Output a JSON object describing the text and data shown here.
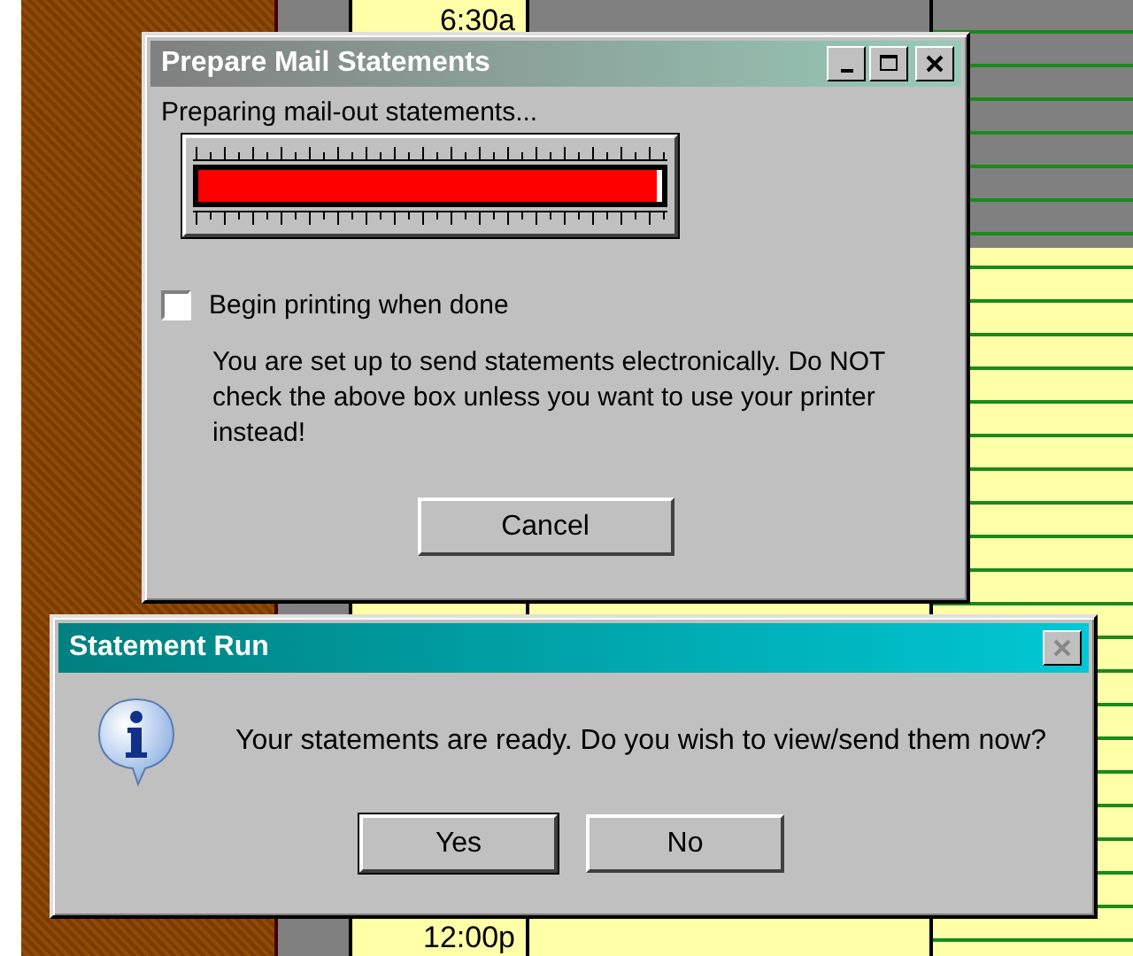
{
  "background": {
    "time_labels": [
      "6:30a",
      "12:00p"
    ]
  },
  "progress_dialog": {
    "title": "Prepare Mail Statements",
    "status": "Preparing mail-out statements...",
    "progress": {
      "level": 0.99
    },
    "checkbox": {
      "label": "Begin printing when done",
      "checked": false
    },
    "note": "You are set up to send statements electronically. Do NOT check the above box unless you want to use your printer instead!",
    "buttons": [
      "Cancel"
    ]
  },
  "message_box": {
    "title": "Statement Run",
    "close_disabled": true,
    "message": "Your statements are ready. Do you wish to view/send them now?",
    "buttons": [
      {
        "label": "Yes",
        "default": true
      },
      {
        "label": "No",
        "default": false
      }
    ]
  }
}
